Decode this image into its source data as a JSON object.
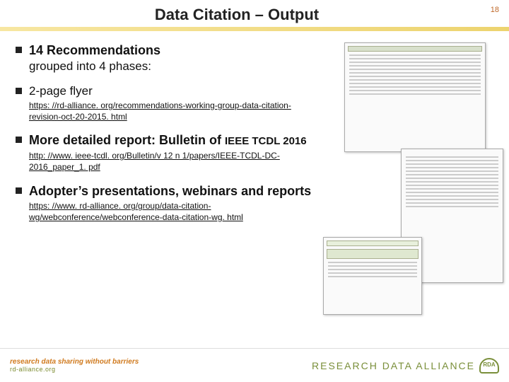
{
  "page_number": "18",
  "title": "Data Citation – Output",
  "bullets": {
    "b1_head": "14 Recommendations",
    "b1_sub": "grouped into 4 phases:",
    "b2_text": "2-page flyer",
    "b2_link": "https: //rd-alliance. org/recommendations-working-group-data-citation-revision-oct-20-2015. html",
    "b3_text_a": "More detailed report: Bulletin of ",
    "b3_text_b": "IEEE TCDL 2016",
    "b3_link": "http: //www. ieee-tcdl. org/Bulletin/v 12 n 1/papers/IEEE-TCDL-DC-2016_paper_1. pdf",
    "b4_text": "Adopter’s presentations, webinars and reports",
    "b4_link": "https: //www. rd-alliance. org/group/data-citation-wg/webconference/webconference-data-citation-wg. html"
  },
  "footer": {
    "tagline1": "research data sharing without barriers",
    "tagline2": "rd-alliance.org",
    "org": "RESEARCH DATA ALLIANCE"
  }
}
